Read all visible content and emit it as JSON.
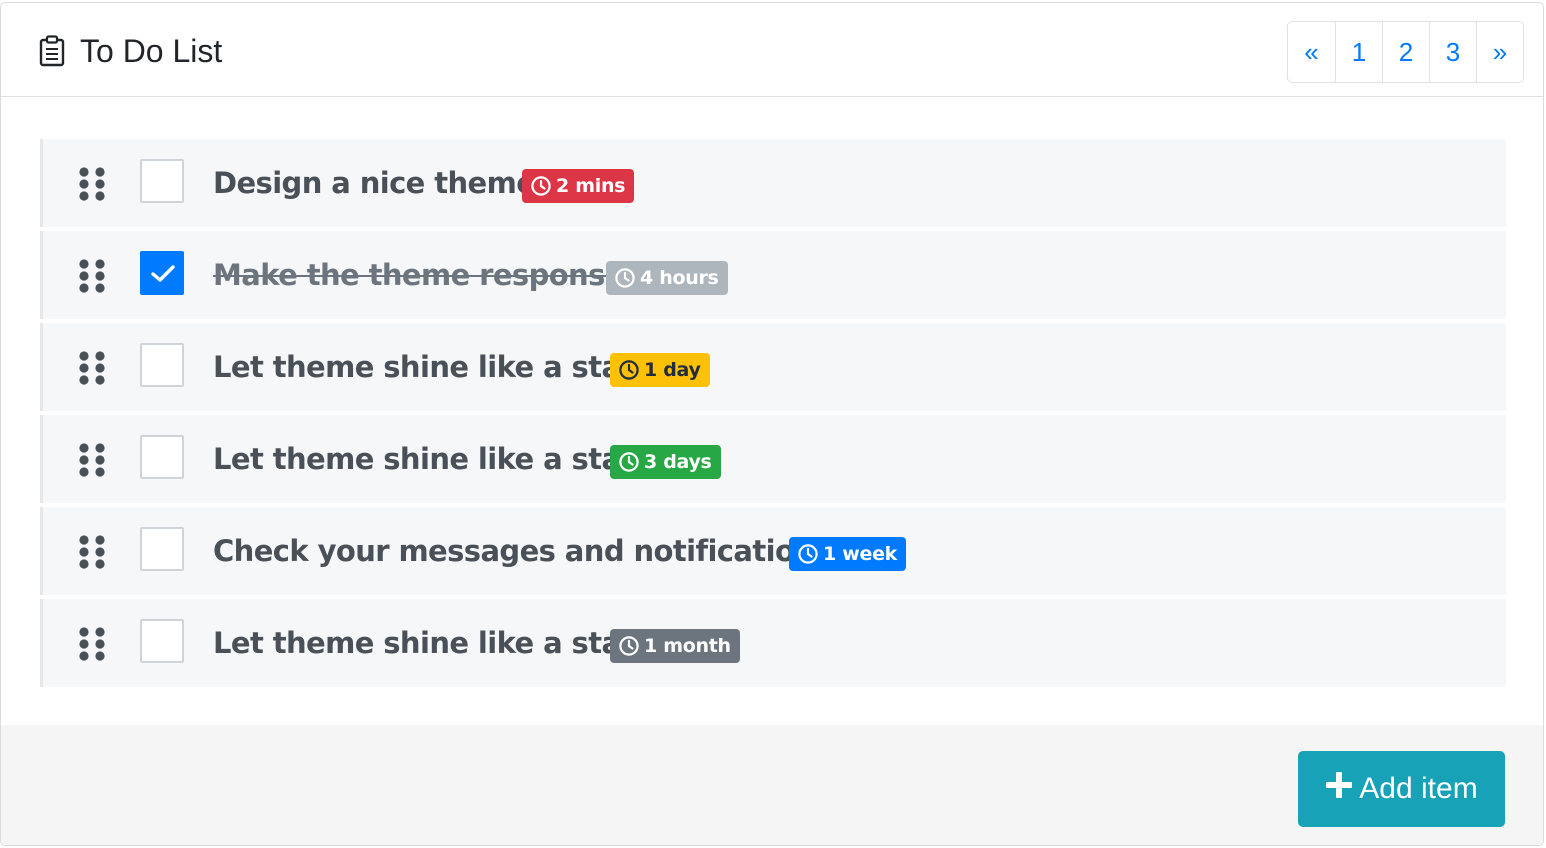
{
  "card": {
    "title": "To Do List",
    "title_icon": "clipboard-icon"
  },
  "pagination": {
    "prev": "«",
    "pages": [
      "1",
      "2",
      "3"
    ],
    "next": "»",
    "color": "#007bff"
  },
  "todos": [
    {
      "text": "Design a nice theme",
      "checked": false,
      "badge": "2 mins",
      "badge_bg": "#dc3545",
      "badge_fg": "#ffffff"
    },
    {
      "text": "Make the theme responsive",
      "checked": true,
      "badge": "4 hours",
      "badge_bg": "#adb5bd",
      "badge_fg": "#ffffff"
    },
    {
      "text": "Let theme shine like a star",
      "checked": false,
      "badge": "1 day",
      "badge_bg": "#ffc107",
      "badge_fg": "#1f2d3d"
    },
    {
      "text": "Let theme shine like a star",
      "checked": false,
      "badge": "3 days",
      "badge_bg": "#28a745",
      "badge_fg": "#ffffff"
    },
    {
      "text": "Check your messages and notifications",
      "checked": false,
      "badge": "1 week",
      "badge_bg": "#007bff",
      "badge_fg": "#ffffff"
    },
    {
      "text": "Let theme shine like a star",
      "checked": false,
      "badge": "1 month",
      "badge_bg": "#6c757d",
      "badge_fg": "#ffffff"
    }
  ],
  "footer": {
    "add_label": "Add item",
    "add_color": "#17a2b8"
  },
  "icons": {
    "drag": "drag-handle-icon",
    "clock": "clock-icon",
    "check": "check-icon",
    "plus": "plus-icon"
  }
}
